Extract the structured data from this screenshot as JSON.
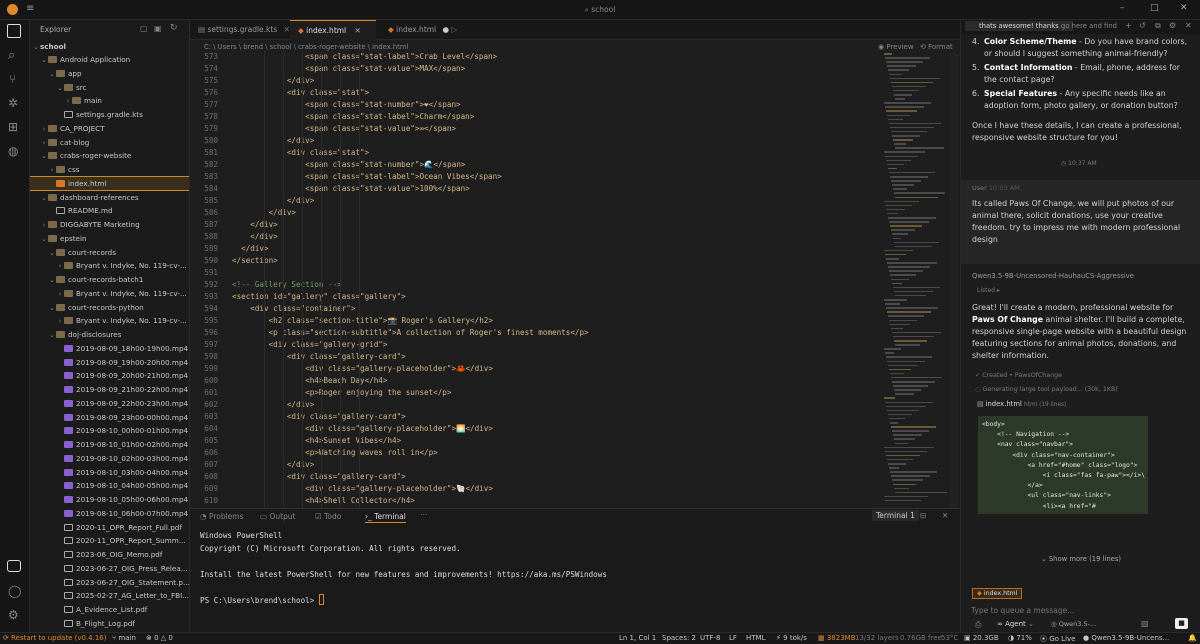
{
  "titlebar": {
    "search": "school"
  },
  "activity": {
    "items": [
      "files-icon",
      "search-icon",
      "source-control-icon",
      "debug-icon",
      "extensions-icon",
      "globe-icon"
    ],
    "bottom": [
      "chat-icon",
      "account-icon",
      "settings-icon"
    ]
  },
  "explorer": {
    "header": "Explorer",
    "root": "school",
    "items": [
      {
        "label": "Android Application",
        "depth": 1,
        "type": "folder",
        "open": true
      },
      {
        "label": "app",
        "depth": 2,
        "type": "folder",
        "open": true
      },
      {
        "label": "src",
        "depth": 3,
        "type": "folder",
        "open": true
      },
      {
        "label": "main",
        "depth": 4,
        "type": "folder",
        "open": false
      },
      {
        "label": "settings.gradle.kts",
        "depth": 3,
        "type": "doc"
      },
      {
        "label": "CA_PROJECT",
        "depth": 1,
        "type": "folder",
        "open": false
      },
      {
        "label": "cat-blog",
        "depth": 1,
        "type": "folder",
        "open": false
      },
      {
        "label": "crabs-roger-website",
        "depth": 1,
        "type": "folder",
        "open": true
      },
      {
        "label": "css",
        "depth": 2,
        "type": "folder",
        "open": false
      },
      {
        "label": "index.html",
        "depth": 2,
        "type": "html",
        "selected": true
      },
      {
        "label": "dashboard-references",
        "depth": 1,
        "type": "folder",
        "open": true
      },
      {
        "label": "README.md",
        "depth": 2,
        "type": "doc"
      },
      {
        "label": "DIGGABYTE Marketing",
        "depth": 1,
        "type": "folder",
        "open": false
      },
      {
        "label": "epstein",
        "depth": 1,
        "type": "folder",
        "open": true
      },
      {
        "label": "court-records",
        "depth": 2,
        "type": "folder",
        "open": true
      },
      {
        "label": "Bryant v. Indyke, No. 119-cv-...",
        "depth": 3,
        "type": "folder",
        "open": false
      },
      {
        "label": "court-records-batch1",
        "depth": 2,
        "type": "folder",
        "open": true
      },
      {
        "label": "Bryant v. Indyke, No. 119-cv-...",
        "depth": 3,
        "type": "folder",
        "open": false
      },
      {
        "label": "court-records-python",
        "depth": 2,
        "type": "folder",
        "open": true
      },
      {
        "label": "Bryant v. Indyke, No. 119-cv-...",
        "depth": 3,
        "type": "folder",
        "open": false
      },
      {
        "label": "doj-disclosures",
        "depth": 2,
        "type": "folder",
        "open": true
      },
      {
        "label": "2019-08-09_18h00-19h00.mp4",
        "depth": 3,
        "type": "mp4"
      },
      {
        "label": "2019-08-09_19h00-20h00.mp4",
        "depth": 3,
        "type": "mp4"
      },
      {
        "label": "2019-08-09_20h00-21h00.mp4",
        "depth": 3,
        "type": "mp4"
      },
      {
        "label": "2019-08-09_21h00-22h00.mp4",
        "depth": 3,
        "type": "mp4"
      },
      {
        "label": "2019-08-09_22h00-23h00.mp4",
        "depth": 3,
        "type": "mp4"
      },
      {
        "label": "2019-08-09_23h00-00h00.mp4",
        "depth": 3,
        "type": "mp4"
      },
      {
        "label": "2019-08-10_00h00-01h00.mp4",
        "depth": 3,
        "type": "mp4"
      },
      {
        "label": "2019-08-10_01h00-02h00.mp4",
        "depth": 3,
        "type": "mp4"
      },
      {
        "label": "2019-08-10_02h00-03h00.mp4",
        "depth": 3,
        "type": "mp4"
      },
      {
        "label": "2019-08-10_03h00-04h00.mp4",
        "depth": 3,
        "type": "mp4"
      },
      {
        "label": "2019-08-10_04h00-05h00.mp4",
        "depth": 3,
        "type": "mp4"
      },
      {
        "label": "2019-08-10_05h00-06h00.mp4",
        "depth": 3,
        "type": "mp4"
      },
      {
        "label": "2019-08-10_06h00-07h00.mp4",
        "depth": 3,
        "type": "mp4"
      },
      {
        "label": "2020-11_OPR_Report_Full.pdf",
        "depth": 3,
        "type": "doc"
      },
      {
        "label": "2020-11_OPR_Report_Summ...",
        "depth": 3,
        "type": "doc"
      },
      {
        "label": "2023-06_OIG_Memo.pdf",
        "depth": 3,
        "type": "doc"
      },
      {
        "label": "2023-06-27_OIG_Press_Relea...",
        "depth": 3,
        "type": "doc"
      },
      {
        "label": "2023-06-27_OIG_Statement.p...",
        "depth": 3,
        "type": "doc"
      },
      {
        "label": "2025-02-27_AG_Letter_to_FBI...",
        "depth": 3,
        "type": "doc"
      },
      {
        "label": "A_Evidence_List.pdf",
        "depth": 3,
        "type": "doc"
      },
      {
        "label": "B_Flight_Log.pdf",
        "depth": 3,
        "type": "doc"
      }
    ]
  },
  "tabs": [
    {
      "label": "settings.gradle.kts",
      "active": false
    },
    {
      "label": "index.html",
      "active": true
    },
    {
      "label": "index.html",
      "active": false,
      "dirty": true
    }
  ],
  "breadcrumb": "C: \\ Users \\ brend \\ school \\ crabs-roger-website \\ index.html",
  "editor_actions": [
    "Preview",
    "Format"
  ],
  "code": [
    {
      "n": "573",
      "text": "                <span class=\"stat-label\">Crab Level</span>"
    },
    {
      "n": "574",
      "text": "                <span class=\"stat-value\">MAX</span>"
    },
    {
      "n": "575",
      "text": "            </div>"
    },
    {
      "n": "576",
      "text": "            <div class=\"stat\">"
    },
    {
      "n": "577",
      "text": "                <span class=\"stat-number\">❤</span>"
    },
    {
      "n": "578",
      "text": "                <span class=\"stat-label\">Charm</span>"
    },
    {
      "n": "579",
      "text": "                <span class=\"stat-value\">∞</span>"
    },
    {
      "n": "580",
      "text": "            </div>"
    },
    {
      "n": "581",
      "text": "            <div class=\"stat\">"
    },
    {
      "n": "582",
      "text": "                <span class=\"stat-number\">🌊</span>"
    },
    {
      "n": "583",
      "text": "                <span class=\"stat-label\">Ocean Vibes</span>"
    },
    {
      "n": "584",
      "text": "                <span class=\"stat-value\">100%</span>"
    },
    {
      "n": "585",
      "text": "            </div>"
    },
    {
      "n": "586",
      "text": "        </div>"
    },
    {
      "n": "587",
      "text": "    </div>"
    },
    {
      "n": "588",
      "text": "    </div>"
    },
    {
      "n": "589",
      "text": "  </div>"
    },
    {
      "n": "590",
      "text": "</section>"
    },
    {
      "n": "591",
      "text": ""
    },
    {
      "n": "592",
      "text": "<!-- Gallery Section -->"
    },
    {
      "n": "593",
      "text": "<section id=\"gallery\" class=\"gallery\">"
    },
    {
      "n": "594",
      "text": "    <div class=\"container\">"
    },
    {
      "n": "595",
      "text": "        <h2 class=\"section-title\">📸 Roger's Gallery</h2>"
    },
    {
      "n": "596",
      "text": "        <p class=\"section-subtitle\">A collection of Roger's finest moments</p>"
    },
    {
      "n": "597",
      "text": "        <div class=\"gallery-grid\">"
    },
    {
      "n": "598",
      "text": "            <div class=\"gallery-card\">"
    },
    {
      "n": "599",
      "text": "                <div class=\"gallery-placeholder\">🦀</div>"
    },
    {
      "n": "600",
      "text": "                <h4>Beach Day</h4>"
    },
    {
      "n": "601",
      "text": "                <p>Roger enjoying the sunset</p>"
    },
    {
      "n": "602",
      "text": "            </div>"
    },
    {
      "n": "603",
      "text": "            <div class=\"gallery-card\">"
    },
    {
      "n": "604",
      "text": "                <div class=\"gallery-placeholder\">🌅</div>"
    },
    {
      "n": "605",
      "text": "                <h4>Sunset Vibes</h4>"
    },
    {
      "n": "606",
      "text": "                <p>Watching waves roll in</p>"
    },
    {
      "n": "607",
      "text": "            </div>"
    },
    {
      "n": "608",
      "text": "            <div class=\"gallery-card\">"
    },
    {
      "n": "609",
      "text": "                <div class=\"gallery-placeholder\">🐚</div>"
    },
    {
      "n": "610",
      "text": "                <h4>Shell Collector</h4>"
    }
  ],
  "panel": {
    "tabs": [
      "Problems",
      "Output",
      "Todo",
      "Terminal"
    ],
    "active_tab": "Terminal",
    "terminal_name": "Terminal 1",
    "lines": [
      "Windows PowerShell",
      "Copyright (C) Microsoft Corporation. All rights reserved.",
      "",
      "Install the latest PowerShell for new features and improvements! https://aka.ms/PSWindows",
      "",
      "PS C:\\Users\\brend\\school> "
    ]
  },
  "chat": {
    "tabs": [
      "thats awesome! thanks",
      "go here and find"
    ],
    "list": [
      {
        "num": "4.",
        "bold": "Color Scheme/Theme",
        "rest": " - Do you have brand colors, or should I suggest something animal-friendly?"
      },
      {
        "num": "5.",
        "bold": "Contact Information",
        "rest": " - Email, phone, address for the contact page?"
      },
      {
        "num": "6.",
        "bold": "Special Features",
        "rest": " - Any specific needs like an adoption form, photo gallery, or donation button?"
      }
    ],
    "closing": "Once I have these details, I can create a professional, responsive website structure for you!",
    "ts1": "10:37 AM",
    "user_label": "User",
    "user_time": "10:03 AM",
    "user_msg": "Its called Paws Of Change, we will put photos of our animal there, solicit donations, use your creative freedom. try to impress me with modern professional design",
    "model_name": "Qwen3.5-9B-Uncensored-HauhauCS-Aggressive",
    "model_sub": "Listed ▸",
    "reply_pre": "Great! I'll create a modern, professional website for ",
    "reply_bold": "Paws Of Change",
    "reply_post": " animal shelter. I'll build a complete, responsive single-page website with a beautiful design featuring sections for animal photos, donations, and shelter information.",
    "step1": "Created • PawsOfChange",
    "step2": "Generating large tool payload... (30k, 1KB)",
    "file_card": {
      "name": "index.html",
      "meta": "html (19 lines)"
    },
    "code": [
      "<body>",
      "    <!-- Navigation -->",
      "    <nav class=\"navbar\">",
      "        <div class=\"nav-container\">",
      "            <a href=\"#home\" class=\"logo\">",
      "                <i class=\"fas fa-paw\"></i>\\",
      "            </a>",
      "            <ul class=\"nav-links\">",
      "                <li><a href=\"#"
    ],
    "show_more": "Show more (19 lines)",
    "attachment": "index.html",
    "input_placeholder": "Type to queue a message...",
    "mode": "Agent",
    "model_pick": "Qwen3.5-..."
  },
  "status": {
    "restart": "Restart to update (v0.4.16)",
    "branch": "main",
    "errors": "0",
    "warnings": "0",
    "position": "Ln 1, Col 1",
    "spaces": "Spaces: 2",
    "encoding": "UTF-8",
    "eol": "LF",
    "lang": "HTML",
    "speed": "9 tok/s",
    "mem": "3823MB",
    "layers": "13/32 layers",
    "free": "0.76GB free",
    "temp": "53°C",
    "ram": "20.3GB",
    "battery": "71%",
    "golive": "Go Live",
    "model": "Qwen3.5-9B-Uncens..."
  },
  "colors": {
    "accent": "#d88a2c",
    "bg": "#1e1e1e",
    "selection": "#3a2f1c"
  }
}
